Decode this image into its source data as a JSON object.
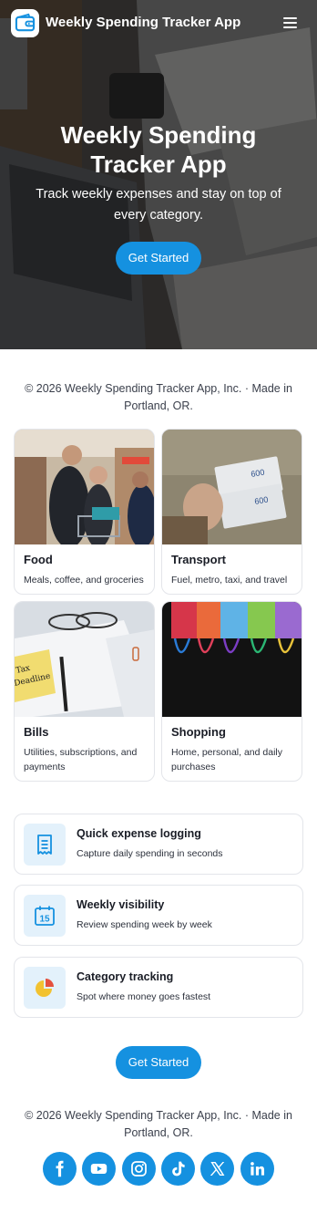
{
  "header": {
    "app_title": "Weekly Spending Tracker App",
    "logo_icon": "wallet-icon",
    "menu_icon": "hamburger-menu-icon"
  },
  "hero": {
    "title": "Weekly Spending Tracker App",
    "subtitle": "Track weekly expenses and stay on top of every category.",
    "cta_label": "Get Started"
  },
  "copyright_text": "© 2026 Weekly Spending Tracker App, Inc. · Made in Portland, OR.",
  "categories": [
    {
      "title": "Food",
      "description": "Meals, coffee, and groceries",
      "image": "grocery-shoppers-photo"
    },
    {
      "title": "Transport",
      "description": "Fuel, metro, taxi, and travel",
      "image": "transit-tickets-photo"
    },
    {
      "title": "Bills",
      "description": "Utilities, subscriptions, and payments",
      "image": "tax-deadline-papers-photo"
    },
    {
      "title": "Shopping",
      "description": "Home, personal, and daily purchases",
      "image": "colorful-shopping-bags-photo"
    }
  ],
  "features": [
    {
      "title": "Quick expense logging",
      "description": "Capture daily spending in seconds",
      "icon": "receipt-icon"
    },
    {
      "title": "Weekly visibility",
      "description": "Review spending week by week",
      "icon": "calendar-15-icon",
      "icon_text": "15"
    },
    {
      "title": "Category tracking",
      "description": "Spot where money goes fastest",
      "icon": "pie-chart-icon"
    }
  ],
  "footer": {
    "cta_label": "Get Started",
    "copyright": "© 2026 Weekly Spending Tracker App, Inc. · Made in Portland, OR.",
    "social": [
      "facebook-icon",
      "youtube-icon",
      "instagram-icon",
      "tiktok-icon",
      "x-icon",
      "linkedin-icon"
    ]
  },
  "colors": {
    "accent": "#1591e0",
    "icon_tile": "#e3f1fb",
    "card_border": "#e3e5ea"
  }
}
